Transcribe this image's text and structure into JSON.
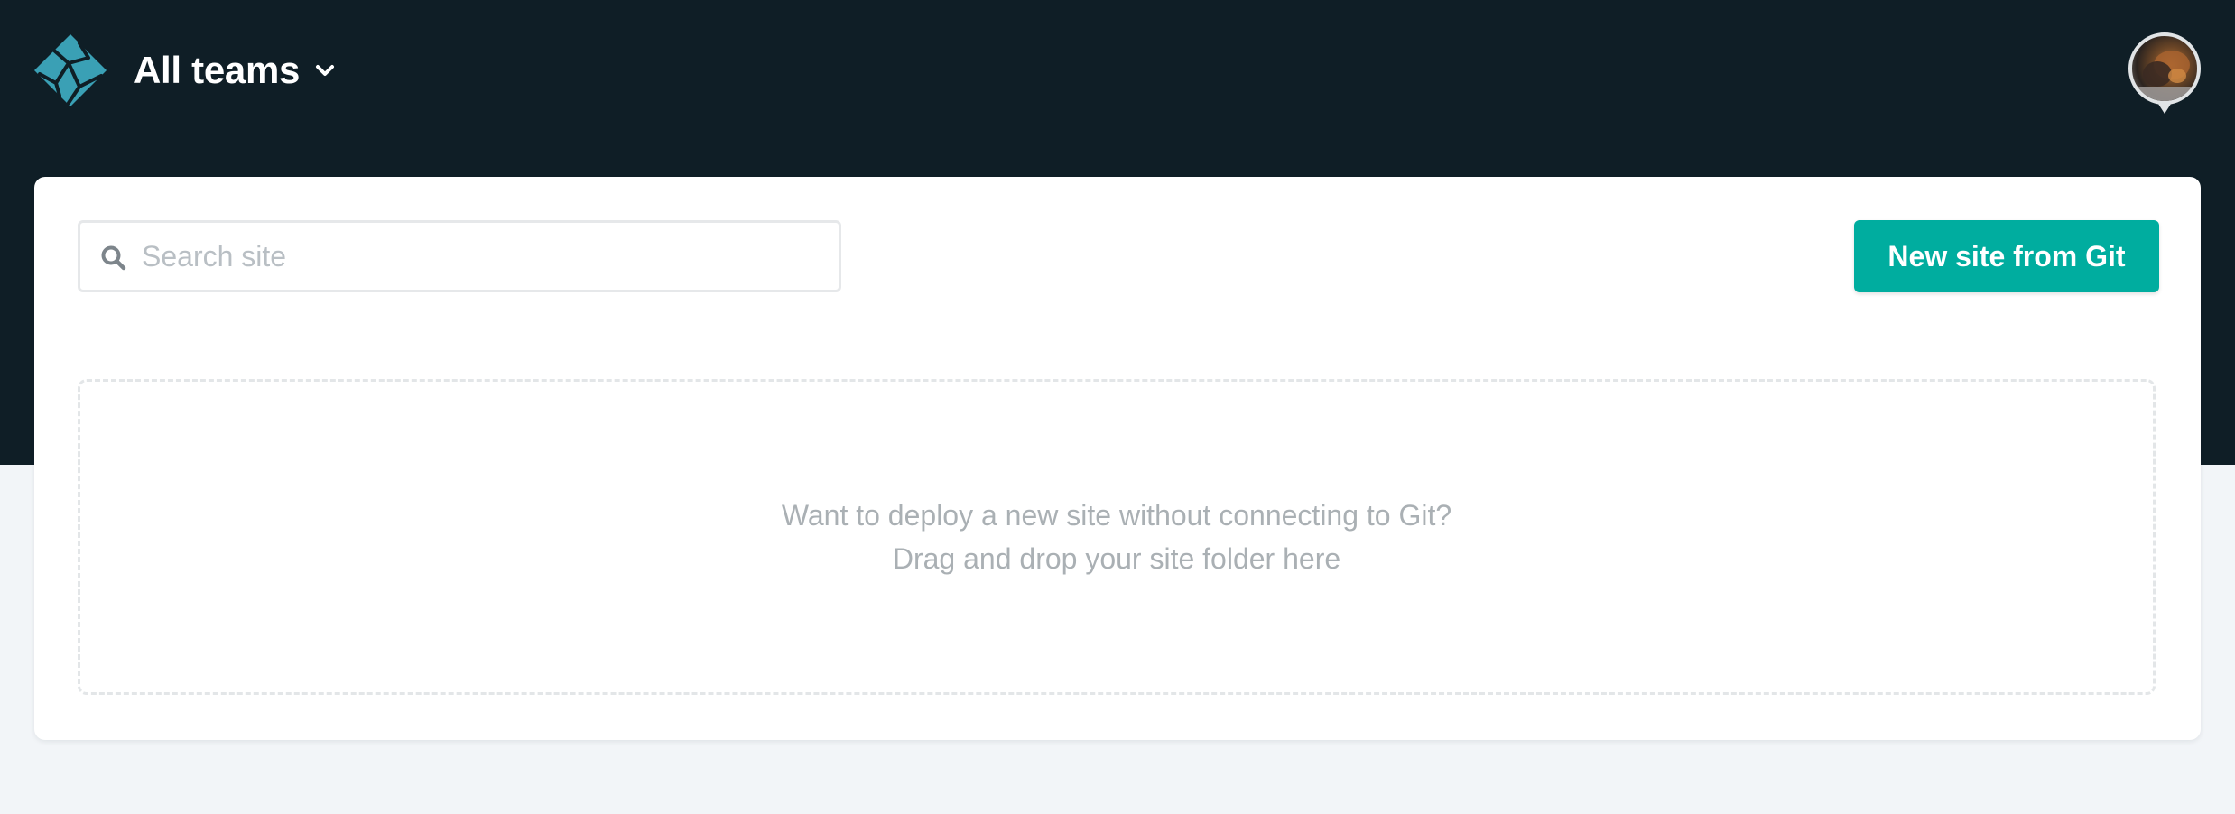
{
  "header": {
    "team_switcher_label": "All teams",
    "icons": {
      "logo": "netlify-logo-icon",
      "chevron": "chevron-down-icon"
    }
  },
  "user": {
    "avatar": "user-avatar"
  },
  "search": {
    "placeholder": "Search site",
    "value": "",
    "icon": "search-icon"
  },
  "actions": {
    "new_site_label": "New site from Git"
  },
  "dropzone": {
    "line1": "Want to deploy a new site without connecting to Git?",
    "line2": "Drag and drop your site folder here"
  },
  "colors": {
    "header_bg": "#0f1e26",
    "page_bg": "#f2f5f8",
    "accent": "#00ad9f",
    "logo_teal": "#3aa0b5",
    "muted_text": "#aab0b4"
  }
}
